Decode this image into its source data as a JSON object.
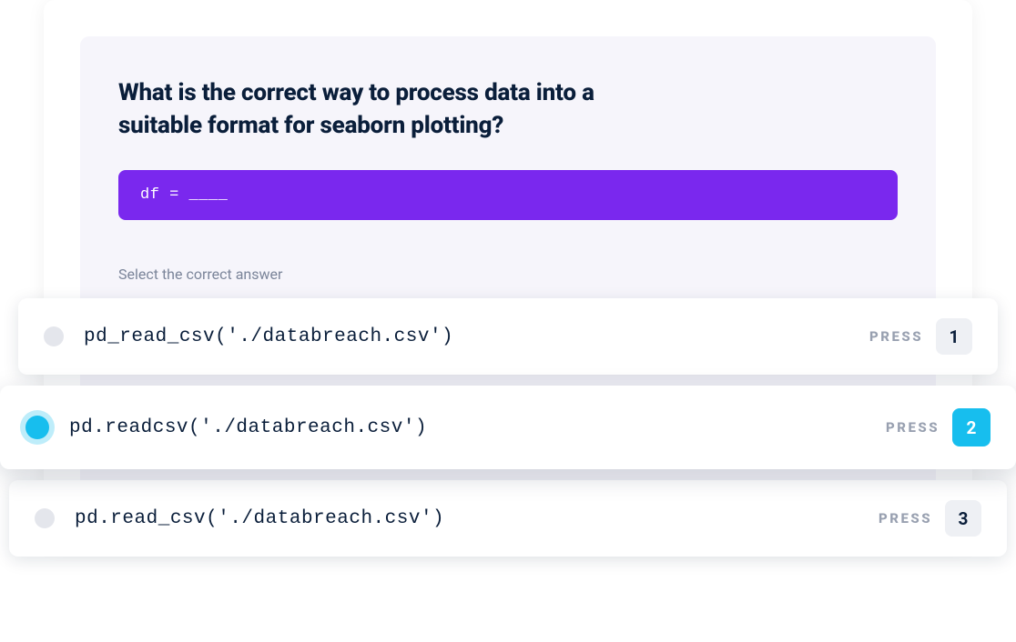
{
  "question": {
    "title": "What is the correct way to process data into a suitable format for seaborn plotting?",
    "code_prompt": "df = ____",
    "instruction": "Select the correct answer"
  },
  "options": [
    {
      "code": "pd_read_csv('./databreach.csv')",
      "press_label": "PRESS",
      "key": "1",
      "selected": false
    },
    {
      "code": "pd.readcsv('./databreach.csv')",
      "press_label": "PRESS",
      "key": "2",
      "selected": true
    },
    {
      "code": "pd.read_csv('./databreach.csv')",
      "press_label": "PRESS",
      "key": "3",
      "selected": false
    }
  ]
}
